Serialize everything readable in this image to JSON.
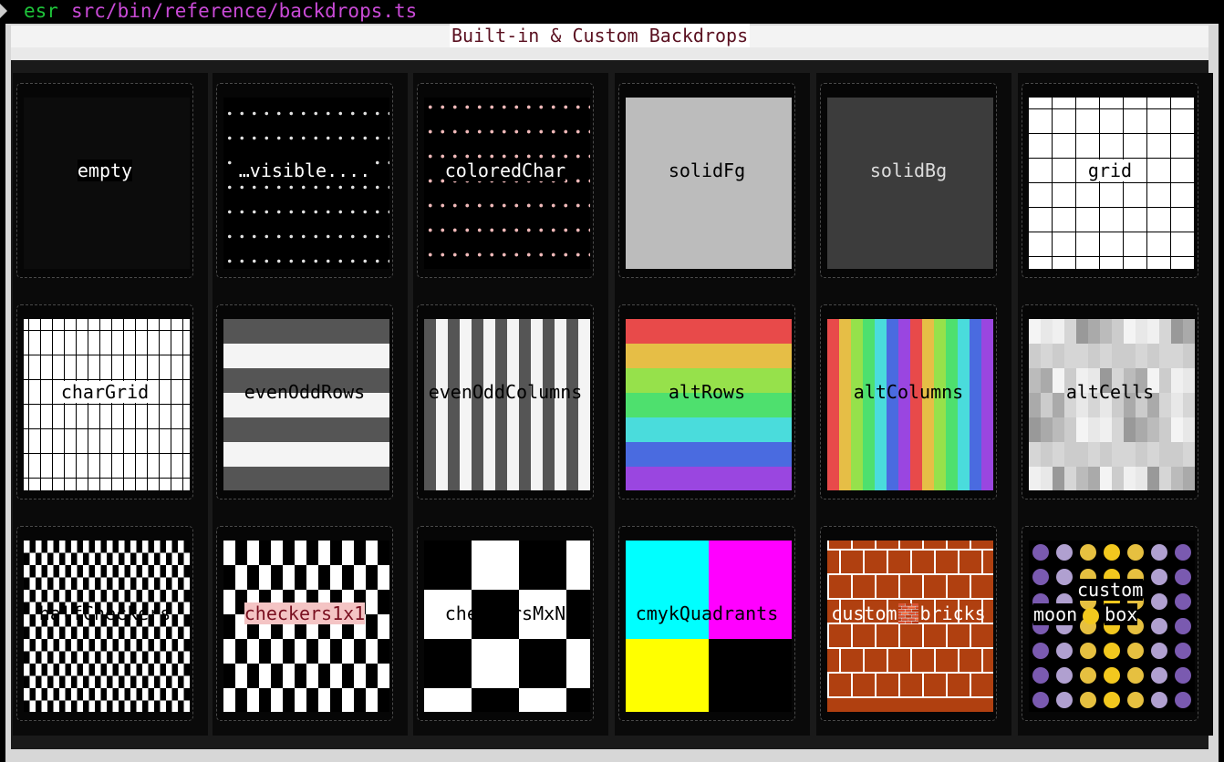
{
  "terminal": {
    "command": "esr",
    "path": "src/bin/reference/backdrops.ts"
  },
  "window": {
    "title": "Built-in & Custom Backdrops"
  },
  "backdrops": [
    {
      "label": "empty"
    },
    {
      "label": "…visible...."
    },
    {
      "label": "coloredChar"
    },
    {
      "label": "solidFg"
    },
    {
      "label": "solidBg"
    },
    {
      "label": "grid"
    },
    {
      "label": "charGrid"
    },
    {
      "label": "evenOddRows"
    },
    {
      "label": "evenOddColumns"
    },
    {
      "label": "altRows"
    },
    {
      "label": "altColumns"
    },
    {
      "label": "altCells"
    },
    {
      "label": "halfCheckers"
    },
    {
      "label": "checkers1x1"
    },
    {
      "label": "checkersMxN"
    },
    {
      "label": "cmykQuadrants"
    },
    {
      "label": "custom🧱bricks"
    },
    {
      "label_line1": "custom",
      "label_line2": "moon",
      "label_line3": "box"
    }
  ],
  "colors": {
    "rainbow": [
      "#e84a4a",
      "#e6be46",
      "#96e14b",
      "#4ee06e",
      "#4adcdc",
      "#4a6be0",
      "#9a46e0"
    ],
    "brick": "#b04010",
    "moon": "#f2c81e"
  }
}
